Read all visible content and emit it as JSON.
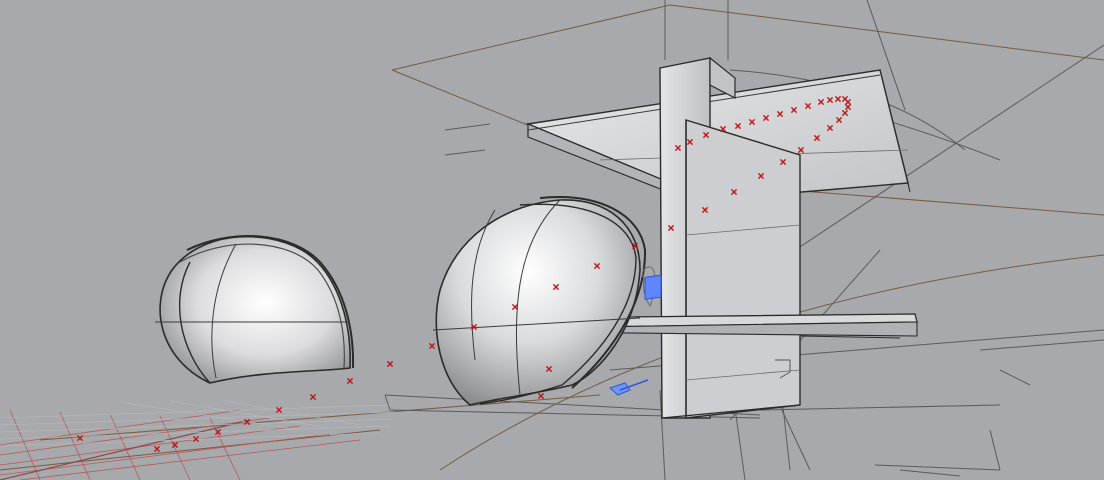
{
  "viewport": {
    "type": "3d-perspective-viewport",
    "background": "#a7a9ad",
    "colors": {
      "shell_fill": "#d7d8da",
      "shell_edge": "#2b2b2b",
      "slab_fill": "#c9cacc",
      "wire": "#7a5a3c",
      "thin_line": "#58595c",
      "grid": "#b65a55",
      "point_marker": "#c11515",
      "gumball": "#4f7bff"
    },
    "icons": {
      "selection_gizmo": "move-gizmo-icon"
    }
  },
  "objects": [
    {
      "id": "shell-left",
      "label": ""
    },
    {
      "id": "shell-right",
      "label": ""
    },
    {
      "id": "tower",
      "label": ""
    },
    {
      "id": "top-slab",
      "label": ""
    },
    {
      "id": "mid-slab",
      "label": ""
    }
  ]
}
